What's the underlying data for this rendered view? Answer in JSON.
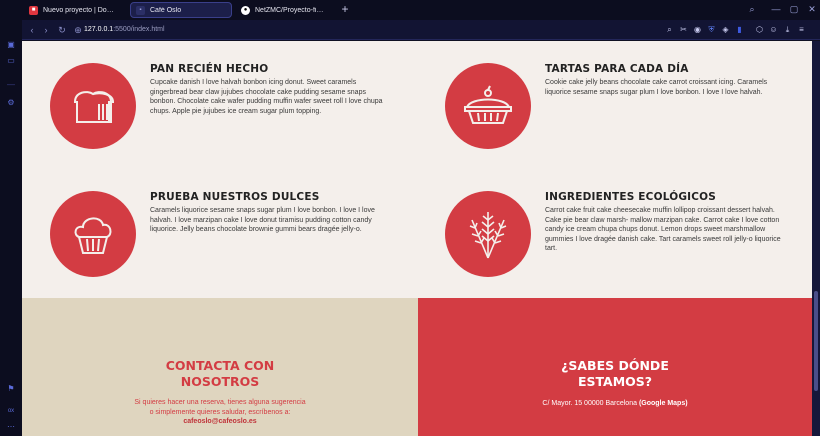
{
  "tabs": [
    {
      "label": "Nuevo proyecto | Domestika",
      "favicon": "domestika-icon",
      "active": false
    },
    {
      "label": "Café Oslo",
      "favicon": "page-icon",
      "active": true
    },
    {
      "label": "NetZMC/Proyecto-final-de",
      "favicon": "github-icon",
      "active": false
    }
  ],
  "address_bar": {
    "url_host": "127.0.0.1",
    "url_path": ":5500/index.html"
  },
  "features": [
    {
      "title": "PAN RECIÉN HECHO",
      "icon": "bread-icon",
      "body": "Cupcake danish I love halvah bonbon icing donut. Sweet caramels gingerbread bear claw jujubes chocolate cake pudding sesame snaps bonbon. Chocolate cake wafer pudding muffin wafer sweet roll I love chupa chups. Apple pie jujubes ice cream sugar plum topping."
    },
    {
      "title": "TARTAS PARA CADA DÍA",
      "icon": "pie-icon",
      "body": "Cookie cake jelly beans chocolate cake carrot croissant icing. Caramels liquorice sesame snaps sugar plum I love bonbon. I love I love halvah."
    },
    {
      "title": "PRUEBA NUESTROS DULCES",
      "icon": "muffin-icon",
      "body": "Caramels liquorice sesame snaps sugar plum I love bonbon. I love I love halvah. I love marzipan cake I love donut tiramisu pudding cotton candy liquorice. Jelly beans chocolate brownie gummi bears dragée jelly-o."
    },
    {
      "title": "INGREDIENTES ECOLÓGICOS",
      "icon": "wheat-icon",
      "body": "Carrot cake fruit cake cheesecake muffin lollipop croissant dessert halvah. Cake pie bear claw marsh- mallow marzipan cake. Carrot cake I love cotton candy ice cream chupa chups donut. Lemon drops sweet marshmallow gummies I love dragée danish cake. Tart caramels sweet roll jelly-o liquorice tart."
    }
  ],
  "contact": {
    "title_line1": "CONTACTA CON",
    "title_line2": "NOSOTROS",
    "text_line1": "Si quieres hacer una reserva, tienes alguna sugerencia",
    "text_line2": "o simplemente quieres saludar, escríbenos a:",
    "email": "cafeoslo@cafeoslo.es"
  },
  "location": {
    "title_line1": "¿SABES DÓNDE",
    "title_line2": "ESTAMOS?",
    "address": "C/ Mayor. 15 00000 Barcelona",
    "maps_link": "(Google Maps)"
  },
  "sidebar": {
    "bottom_label": "ox"
  },
  "colors": {
    "accent_red": "#d33c43",
    "beige": "#dfd5bf",
    "page_bg": "#f4efeb",
    "browser_dark": "#0c0d1f"
  }
}
